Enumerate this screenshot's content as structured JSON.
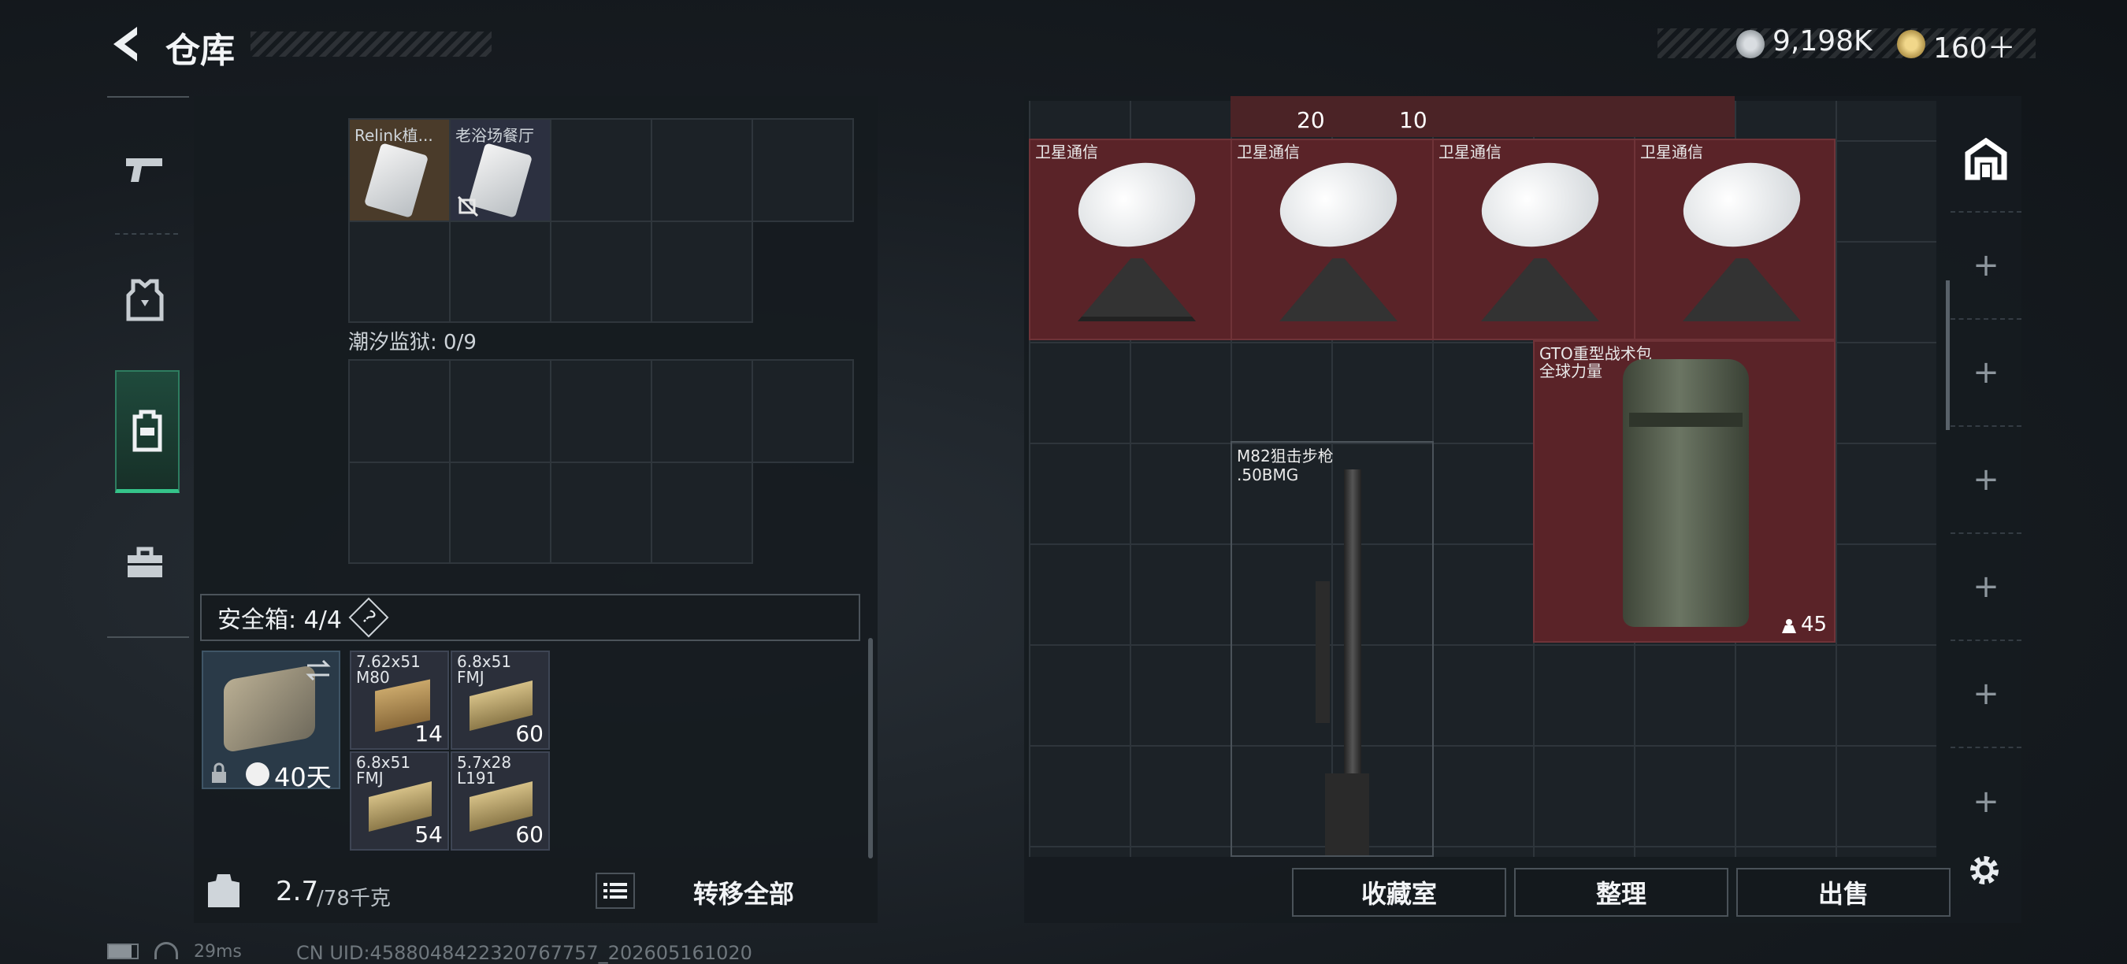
{
  "header": {
    "back_icon": "chevron-left-icon",
    "title": "仓库",
    "currency1_icon": "silver-coin-icon",
    "currency1_value": "9,198K",
    "currency2_icon": "gold-coin-icon",
    "currency2_value": "160＋"
  },
  "left_nav": [
    "pistol-icon",
    "armor-icon",
    "backpack-icon",
    "toolbox-icon"
  ],
  "left_panel": {
    "containers": [
      {
        "items": [
          {
            "name": "Relink植...",
            "kind": "card-icon"
          },
          {
            "name": "老浴场餐厅",
            "kind": "card-icon",
            "badge": "no-signal-icon"
          }
        ]
      },
      {
        "title": "潮汐监狱: 0/9",
        "items": []
      }
    ],
    "safe_box": {
      "label": "安全箱: 4/4",
      "help": "?",
      "timer": "40天",
      "ammo": [
        {
          "name": "7.62x51\nM80",
          "count": "14"
        },
        {
          "name": "6.8x51\nFMJ",
          "count": "60"
        },
        {
          "name": "6.8x51\nFMJ",
          "count": "54"
        },
        {
          "name": "5.7x28\nL191",
          "count": "60"
        }
      ]
    },
    "weight_current": "2.7",
    "weight_max": "/78千克",
    "transfer_all": "转移全部"
  },
  "right_panel": {
    "top_partial_counts": [
      "20",
      "10"
    ],
    "satellites": [
      "卫星通信",
      "卫星通信",
      "卫星通信",
      "卫星通信"
    ],
    "backpack": {
      "name_line1": "GTO重型战术包",
      "name_line2": "全球力量",
      "count": "45"
    },
    "rifle": {
      "name_line1": "M82狙击步枪",
      "name_line2": ".50BMG"
    },
    "buttons": {
      "collection": "收藏室",
      "organize": "整理",
      "sell": "出售"
    }
  },
  "right_nav": [
    "home-vault-icon",
    "plus-icon",
    "plus-icon",
    "plus-icon",
    "plus-icon",
    "plus-icon",
    "plus-icon"
  ],
  "status_bar": {
    "ping": "29ms",
    "uid": "CN UID:4588048422320767757_202605161020"
  },
  "colors": {
    "item_red": "#5a2328",
    "grid_bg": "#1c2227",
    "accent_green": "#35c48a"
  }
}
